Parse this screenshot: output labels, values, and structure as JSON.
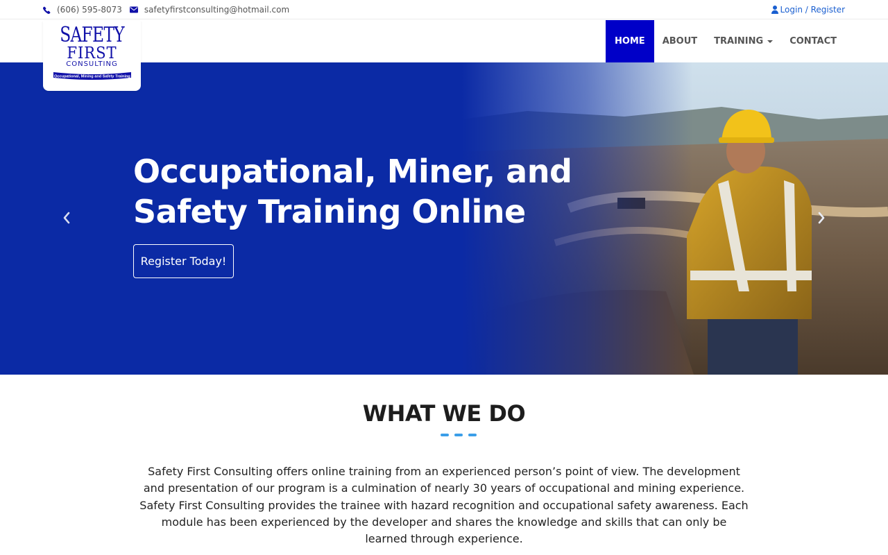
{
  "topbar": {
    "phone": "(606) 595-8073",
    "email": "safetyfirstconsulting@hotmail.com",
    "login": "Login / Register"
  },
  "logo": {
    "line1": "SAFETY",
    "line2": "FIRST",
    "line3": "CONSULTING",
    "ribbon": "Occupational, Mining and Safety Training"
  },
  "nav": {
    "items": [
      {
        "label": "HOME",
        "active": true
      },
      {
        "label": "ABOUT"
      },
      {
        "label": "TRAINING",
        "dropdown": true
      },
      {
        "label": "CONTACT"
      }
    ]
  },
  "hero": {
    "title": "Occupational, Miner, and Safety Training Online",
    "button": "Register Today!",
    "icons": [
      "chevron-left-icon",
      "chevron-right-icon"
    ]
  },
  "what_we_do": {
    "title": "WHAT WE DO",
    "text": "Safety First Consulting offers online training from an experienced person’s point of view. The development and presentation of our program is a culmination of nearly 30 years of occupational and mining experience. Safety First Consulting provides the trainee with hazard recognition and occupational safety awareness. Each module has been experienced by the developer and shares the knowledge and skills that can only be learned through experience."
  },
  "colors": {
    "brand_blue": "#0000c8",
    "hero_blue": "#0b2aa5",
    "link_blue": "#1a5fd0",
    "dash_blue": "#3b9ee8"
  }
}
